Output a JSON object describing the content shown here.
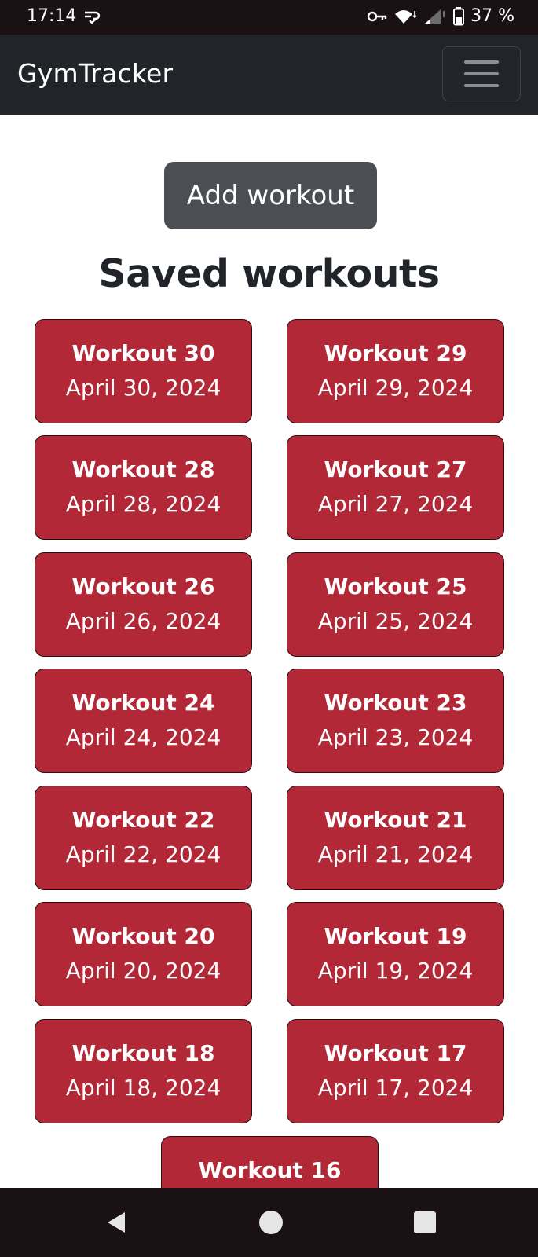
{
  "status_bar": {
    "time": "17:14",
    "battery": "37 %"
  },
  "navbar": {
    "brand": "GymTracker"
  },
  "main": {
    "add_button": "Add workout",
    "heading": "Saved workouts",
    "workouts": [
      {
        "title": "Workout 30",
        "date": "April 30, 2024"
      },
      {
        "title": "Workout 29",
        "date": "April 29, 2024"
      },
      {
        "title": "Workout 28",
        "date": "April 28, 2024"
      },
      {
        "title": "Workout 27",
        "date": "April 27, 2024"
      },
      {
        "title": "Workout 26",
        "date": "April 26, 2024"
      },
      {
        "title": "Workout 25",
        "date": "April 25, 2024"
      },
      {
        "title": "Workout 24",
        "date": "April 24, 2024"
      },
      {
        "title": "Workout 23",
        "date": "April 23, 2024"
      },
      {
        "title": "Workout 22",
        "date": "April 22, 2024"
      },
      {
        "title": "Workout 21",
        "date": "April 21, 2024"
      },
      {
        "title": "Workout 20",
        "date": "April 20, 2024"
      },
      {
        "title": "Workout 19",
        "date": "April 19, 2024"
      },
      {
        "title": "Workout 18",
        "date": "April 18, 2024"
      },
      {
        "title": "Workout 17",
        "date": "April 17, 2024"
      },
      {
        "title": "Workout 16",
        "date": ""
      }
    ]
  },
  "colors": {
    "navbar_bg": "#212529",
    "card_bg": "#b22837",
    "add_button_bg": "#4b4f54",
    "system_bar_bg": "#1a1114"
  },
  "icons": {
    "status": [
      "cast-icon",
      "key-icon",
      "wifi-icon",
      "signal-icon",
      "battery-icon"
    ],
    "navigation": [
      "back-icon",
      "home-icon",
      "recents-icon"
    ]
  }
}
